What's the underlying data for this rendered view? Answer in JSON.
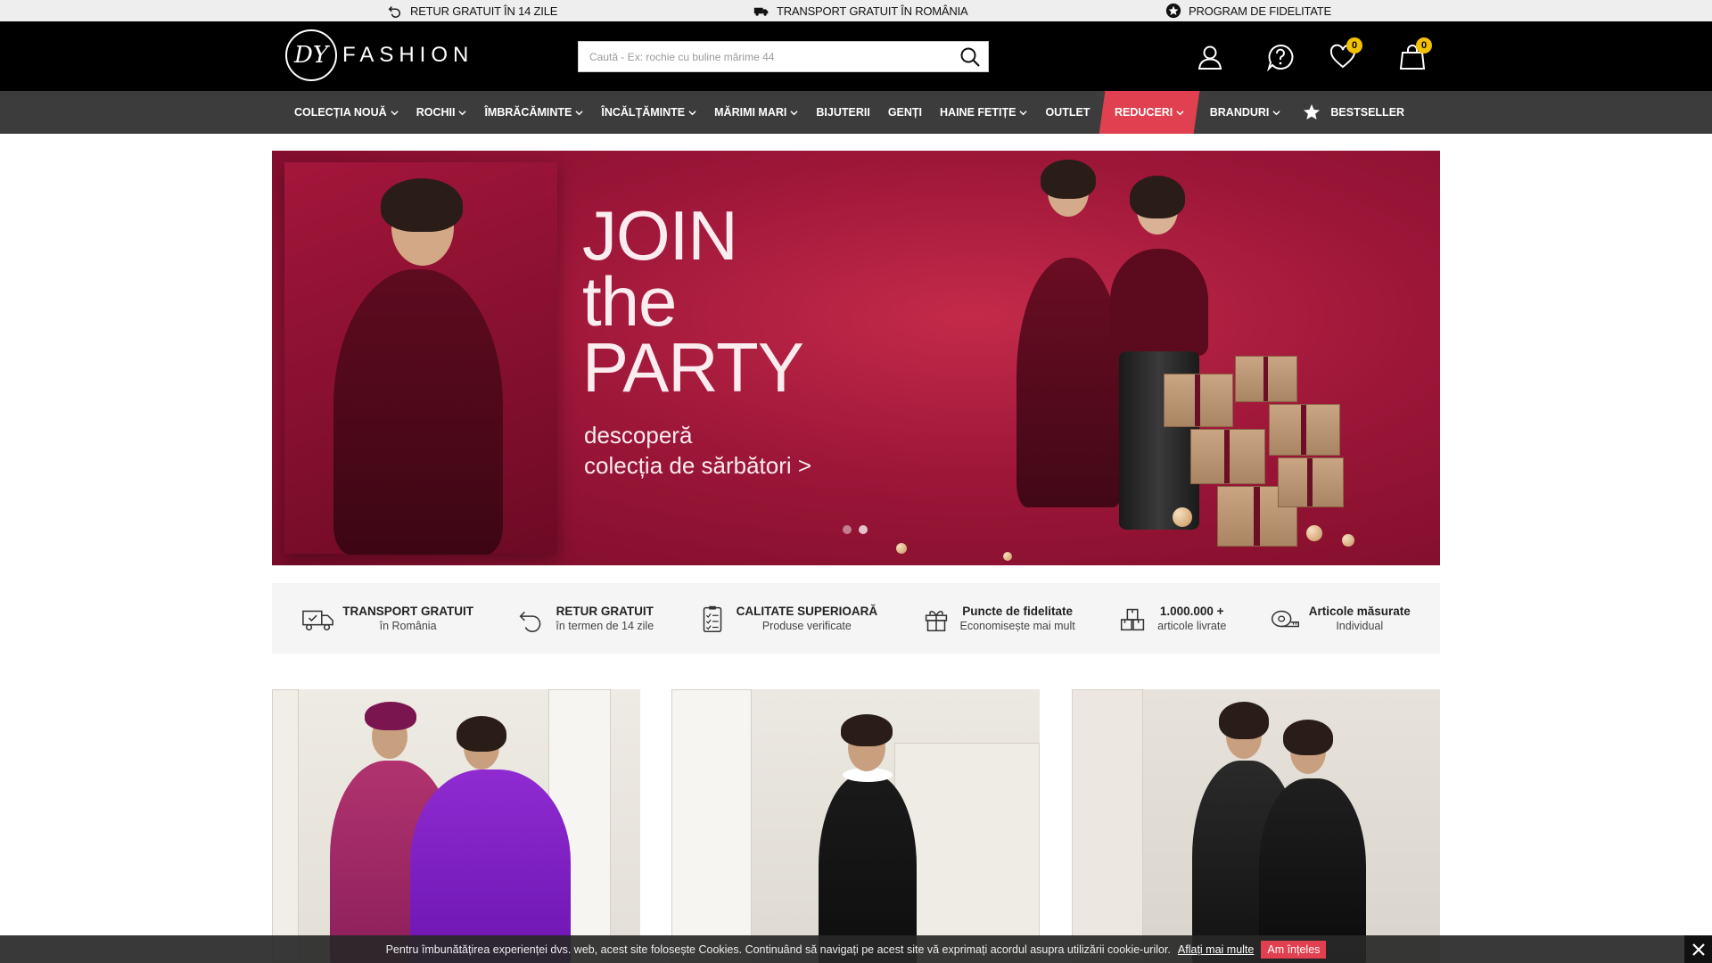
{
  "topbar": {
    "returns": "RETUR GRATUIT ÎN 14 ZILE",
    "shipping": "TRANSPORT GRATUIT ÎN ROMÂNIA",
    "loyalty": "PROGRAM DE FIDELITATE"
  },
  "header": {
    "logo_mark": "DY",
    "logo_text": "FASHION",
    "search_placeholder": "Caută - Ex: rochie cu buline mărime 44",
    "wishlist_count": "0",
    "cart_count": "0"
  },
  "nav": {
    "items": [
      {
        "label": "COLECȚIA NOUĂ",
        "dropdown": true
      },
      {
        "label": "ROCHII",
        "dropdown": true
      },
      {
        "label": "ÎMBRĂCĂMINTE",
        "dropdown": true
      },
      {
        "label": "ÎNCĂLȚĂMINTE",
        "dropdown": true
      },
      {
        "label": "MĂRIMI MARI",
        "dropdown": true
      },
      {
        "label": "BIJUTERII",
        "dropdown": false
      },
      {
        "label": "GENȚI",
        "dropdown": false
      },
      {
        "label": "HAINE FETIȚE",
        "dropdown": true
      },
      {
        "label": "OUTLET",
        "dropdown": false
      },
      {
        "label": "REDUCERI",
        "dropdown": true
      },
      {
        "label": "BRANDURI",
        "dropdown": true
      },
      {
        "label": "BESTSELLER",
        "dropdown": false
      }
    ],
    "sale_color": "#e0404f"
  },
  "hero": {
    "title_line1": "JOIN",
    "title_line2": "the",
    "title_line3": "PARTY",
    "subtitle_line1": "descoperă",
    "subtitle_line2": "colecția de sărbători >",
    "slides": 2,
    "active_slide": 2
  },
  "features": [
    {
      "title": "TRANSPORT GRATUIT",
      "subtitle": "în România",
      "icon": "truck-icon"
    },
    {
      "title": "RETUR GRATUIT",
      "subtitle": "în termen de 14 zile",
      "icon": "return-icon"
    },
    {
      "title": "CALITATE SUPERIOARĂ",
      "subtitle": "Produse verificate",
      "icon": "checklist-icon"
    },
    {
      "title": "Puncte de fidelitate",
      "subtitle": "Economisește mai mult",
      "icon": "gift-icon"
    },
    {
      "title": "1.000.000 +",
      "subtitle": "articole livrate",
      "icon": "boxes-icon"
    },
    {
      "title": "Articole măsurate",
      "subtitle": "Individual",
      "icon": "tape-measure-icon"
    }
  ],
  "cookie": {
    "text": "Pentru îmbunătățirea experienței dvs. web, acest site folosește Cookies. Continuând să navigați pe acest site vă exprimați acordul asupra utilizării cookie-urilor.",
    "link": "Aflați mai multe",
    "accept": "Am înțeles"
  },
  "colors": {
    "header_bg": "#000000",
    "nav_bg": "#3c3c3c",
    "accent_red": "#e0404f",
    "badge_yellow": "#f2c100"
  }
}
